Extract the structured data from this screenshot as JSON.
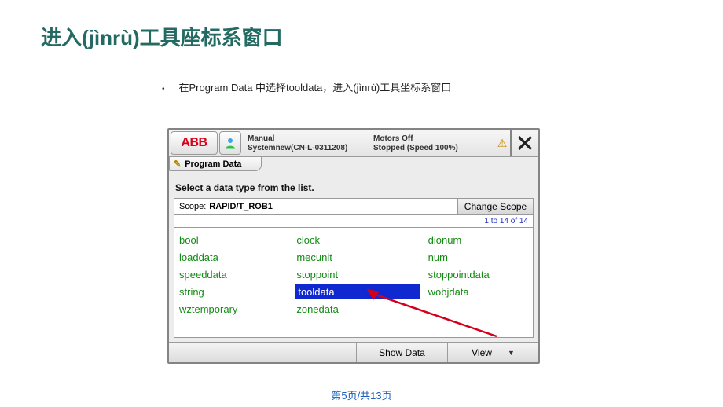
{
  "slide": {
    "title": "进入(jìnrù)工具座标系窗口",
    "bullet": "在Program Data 中选择tooldata，进入(jìnrù)工具坐标系窗口",
    "pageLabel": "第5页/共13页"
  },
  "pendant": {
    "logo": "ABB",
    "status": {
      "mode": "Manual",
      "system": "Systemnew(CN-L-0311208)",
      "motors": "Motors Off",
      "stopped": "Stopped (Speed 100%)"
    },
    "tab": "Program Data",
    "instruction": "Select a data type from the list.",
    "scopeLabel": "Scope:",
    "scopeValue": "RAPID/T_ROB1",
    "changeScope": "Change Scope",
    "countText": "1 to 14 of 14",
    "grid": {
      "rows": [
        [
          "bool",
          "clock",
          "dionum"
        ],
        [
          "loaddata",
          "mecunit",
          "num"
        ],
        [
          "speeddata",
          "stoppoint",
          "stoppointdata"
        ],
        [
          "string",
          "tooldata",
          "wobjdata"
        ],
        [
          "wztemporary",
          "zonedata",
          ""
        ]
      ],
      "selectedLabel": "tooldata"
    },
    "footer": {
      "showData": "Show Data",
      "view": "View"
    }
  }
}
